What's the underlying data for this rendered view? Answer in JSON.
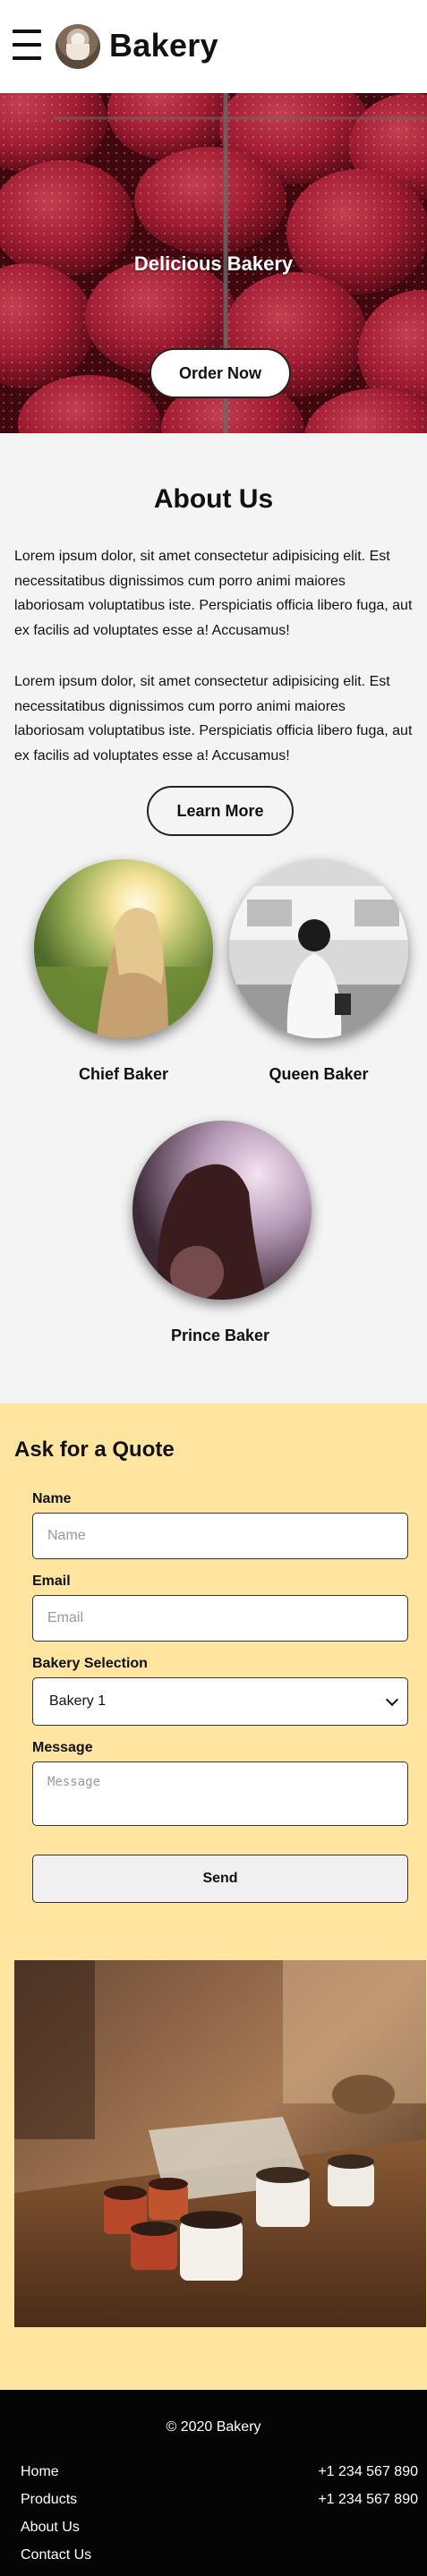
{
  "header": {
    "brand": "Bakery",
    "menu_icon": "hamburger-icon",
    "logo_icon": "coffee-cup-logo"
  },
  "hero": {
    "title": "Delicious Bakery",
    "button": "Order Now"
  },
  "about": {
    "title": "About Us",
    "paragraphs": [
      "Lorem ipsum dolor, sit amet consectetur adipisicing elit. Est necessitatibus dignissimos cum porro animi maiores laboriosam voluptatibus iste. Perspiciatis officia libero fuga, aut ex facilis ad voluptates esse a! Accusamus!",
      "Lorem ipsum dolor, sit amet consectetur adipisicing elit. Est necessitatibus dignissimos cum porro animi maiores laboriosam voluptatibus iste. Perspiciatis officia libero fuga, aut ex facilis ad voluptates esse a! Accusamus!"
    ],
    "button": "Learn More",
    "bakers": [
      {
        "name": "Chief Baker"
      },
      {
        "name": "Queen Baker"
      },
      {
        "name": "Prince Baker"
      }
    ]
  },
  "quote": {
    "title": "Ask for a Quote",
    "name_label": "Name",
    "name_placeholder": "Name",
    "email_label": "Email",
    "email_placeholder": "Email",
    "selection_label": "Bakery Selection",
    "selection_value": "Bakery 1",
    "message_label": "Message",
    "message_placeholder": "Message",
    "send": "Send"
  },
  "footer": {
    "copyright": "© 2020 Bakery",
    "links": [
      "Home",
      "Products",
      "About Us",
      "Contact Us"
    ],
    "phones": [
      "+1 234 567 890",
      "+1 234 567 890"
    ]
  },
  "colors": {
    "quote_bg": "#ffe5a0",
    "footer_bg": "#050505",
    "page_bg": "#f4f4f4"
  }
}
